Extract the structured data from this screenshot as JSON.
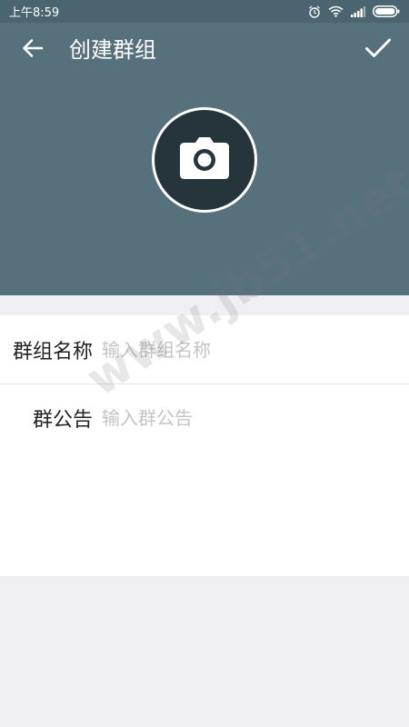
{
  "status_bar": {
    "time": "上午8:59",
    "icons": [
      "alarm-icon",
      "wifi-icon",
      "signal-icon",
      "battery-icon"
    ]
  },
  "header": {
    "title": "创建群组",
    "back_icon": "back-arrow-icon",
    "confirm_icon": "check-icon",
    "avatar_icon": "camera-icon"
  },
  "form": {
    "name": {
      "label": "群组名称",
      "placeholder": "输入群组名称",
      "value": ""
    },
    "notice": {
      "label": "群公告",
      "placeholder": "输入群公告",
      "value": ""
    }
  },
  "watermark": "www.jb51.net",
  "colors": {
    "status_bar": "#4a6470",
    "header": "#56707c",
    "avatar_bg": "#26343b",
    "background": "#efeff4",
    "form_bg": "#ffffff"
  }
}
